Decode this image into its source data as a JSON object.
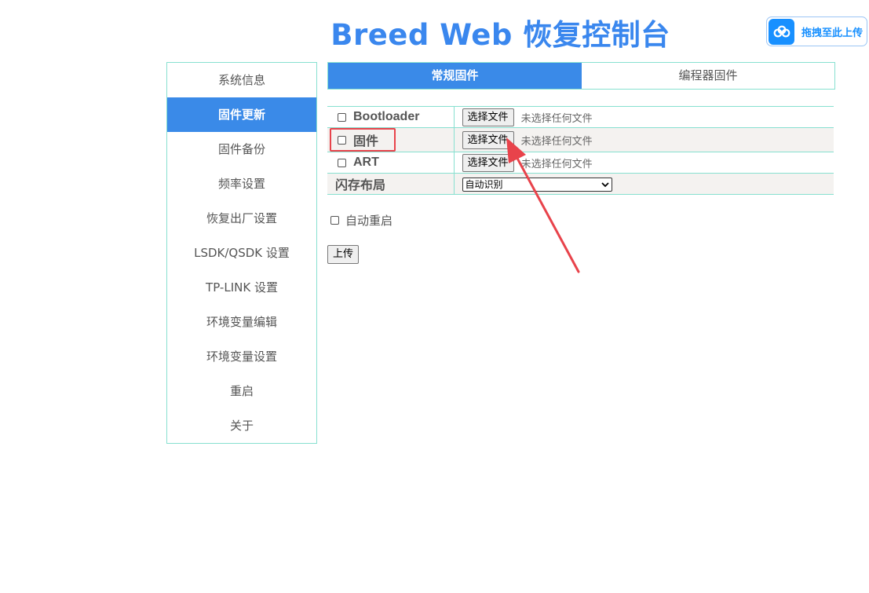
{
  "header": {
    "title": "Breed Web 恢复控制台"
  },
  "drag_upload": {
    "label": "拖拽至此上传",
    "icon": "cloud-icon",
    "color": "#1890ff"
  },
  "sidebar": {
    "items": [
      {
        "label": "系统信息",
        "active": false
      },
      {
        "label": "固件更新",
        "active": true
      },
      {
        "label": "固件备份",
        "active": false
      },
      {
        "label": "频率设置",
        "active": false
      },
      {
        "label": "恢复出厂设置",
        "active": false
      },
      {
        "label": "LSDK/QSDK 设置",
        "active": false
      },
      {
        "label": "TP-LINK 设置",
        "active": false
      },
      {
        "label": "环境变量编辑",
        "active": false
      },
      {
        "label": "环境变量设置",
        "active": false
      },
      {
        "label": "重启",
        "active": false
      },
      {
        "label": "关于",
        "active": false
      }
    ]
  },
  "tabs": [
    {
      "label": "常规固件",
      "active": true
    },
    {
      "label": "编程器固件",
      "active": false
    }
  ],
  "firmware_rows": [
    {
      "label": "Bootloader",
      "checked": false,
      "button": "选择文件",
      "status": "未选择任何文件",
      "highlighted": false
    },
    {
      "label": "固件",
      "checked": false,
      "button": "选择文件",
      "status": "未选择任何文件",
      "highlighted": true
    },
    {
      "label": "ART",
      "checked": false,
      "button": "选择文件",
      "status": "未选择任何文件",
      "highlighted": false
    }
  ],
  "flash_layout": {
    "label": "闪存布局",
    "selected": "自动识别"
  },
  "auto_reboot": {
    "label": "自动重启",
    "checked": false
  },
  "upload_button": {
    "label": "上传"
  },
  "colors": {
    "accent": "#3a8ae8",
    "border": "#87e0d0",
    "annotation": "#e8434b"
  }
}
